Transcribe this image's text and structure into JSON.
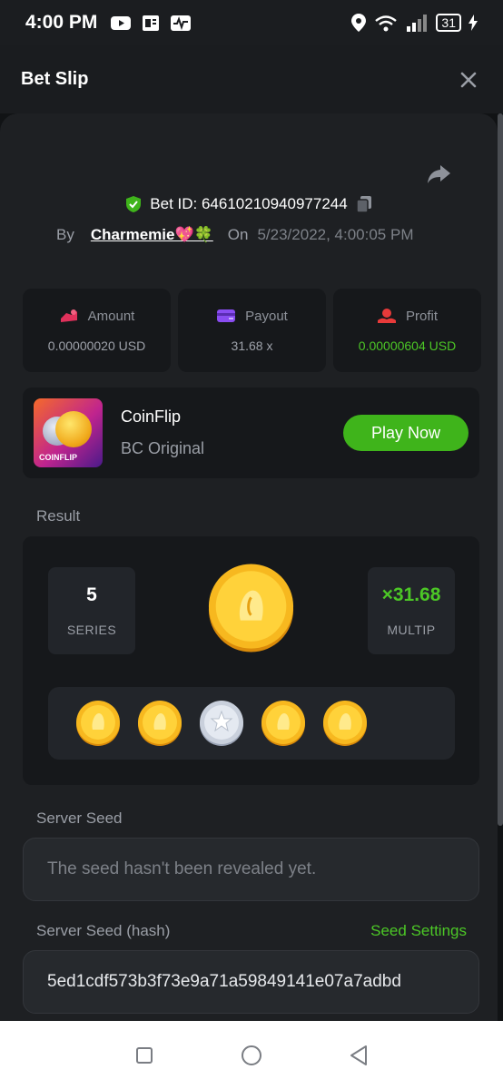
{
  "status_bar": {
    "time": "4:00 PM",
    "battery": "31"
  },
  "header": {
    "title": "Bet Slip"
  },
  "bet": {
    "id_text": "Bet ID: 64610210940977244",
    "by_label": "By",
    "user": "Charmemie💖🍀",
    "on_label": "On",
    "datetime": "5/23/2022, 4:00:05 PM"
  },
  "stats": [
    {
      "label": "Amount",
      "value": "0.00000020 USD",
      "icon": "amount-icon",
      "color": "#e0315b"
    },
    {
      "label": "Payout",
      "value": "31.68 x",
      "icon": "payout-icon",
      "color": "#8a4df2"
    },
    {
      "label": "Profit",
      "value": "0.00000604 USD",
      "icon": "profit-icon",
      "color": "#e83a3a"
    }
  ],
  "game": {
    "name": "CoinFlip",
    "subtitle": "BC Original",
    "play_label": "Play Now",
    "thumb_label": "COINFLIP"
  },
  "result": {
    "section_label": "Result",
    "series_value": "5",
    "series_label": "SERIES",
    "multiplier": "×31.68",
    "multiplier_label": "MULTIP",
    "coins": [
      "gold",
      "gold",
      "silver",
      "gold",
      "gold"
    ]
  },
  "server_seed": {
    "label": "Server Seed",
    "placeholder": "The seed hasn't been revealed yet."
  },
  "server_seed_hash": {
    "label": "Server Seed (hash)",
    "settings_label": "Seed Settings",
    "value": "5ed1cdf573b3f73e9a71a59849141e07a7adbd"
  },
  "colors": {
    "accent": "#4cc726",
    "button": "#3fb41b",
    "background": "#1e2023"
  }
}
